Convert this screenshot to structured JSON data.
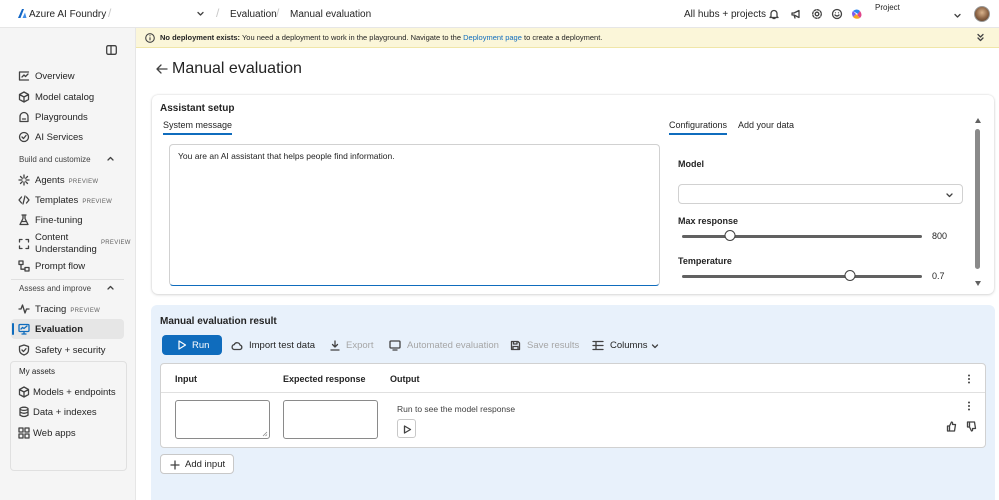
{
  "topbar": {
    "brand": "Azure AI Foundry",
    "breadcrumb": [
      "Evaluation",
      "Manual evaluation"
    ],
    "hubs_label": "All hubs + projects",
    "project_label": "Project"
  },
  "sidebar": {
    "main_items": [
      {
        "label": "Overview",
        "icon": "overview-icon"
      },
      {
        "label": "Model catalog",
        "icon": "model-catalog-icon"
      },
      {
        "label": "Playgrounds",
        "icon": "playgrounds-icon"
      },
      {
        "label": "AI Services",
        "icon": "ai-services-icon"
      }
    ],
    "section_build": "Build and customize",
    "build_items": [
      {
        "label": "Agents",
        "badge": "PREVIEW"
      },
      {
        "label": "Templates",
        "badge": "PREVIEW"
      },
      {
        "label": "Fine-tuning"
      },
      {
        "label": "Content Understanding",
        "badge": "PREVIEW"
      },
      {
        "label": "Prompt flow"
      }
    ],
    "section_assess": "Assess and improve",
    "assess_items": [
      {
        "label": "Tracing",
        "badge": "PREVIEW"
      },
      {
        "label": "Evaluation",
        "active": true
      },
      {
        "label": "Safety + security"
      }
    ],
    "section_assets": "My assets",
    "asset_items": [
      {
        "label": "Models + endpoints"
      },
      {
        "label": "Data + indexes"
      },
      {
        "label": "Web apps"
      }
    ]
  },
  "banner": {
    "title": "No deployment exists:",
    "text": " You need a deployment to work in the playground. Navigate to the ",
    "link": "Deployment page",
    "text2": " to create a deployment."
  },
  "page": {
    "title": "Manual evaluation"
  },
  "setup": {
    "title": "Assistant setup",
    "tab_system": "System message",
    "tab_config": "Configurations",
    "tab_data": "Add your data",
    "system_message": "You are an AI assistant that helps people find information.",
    "model_label": "Model",
    "model_value": "",
    "max_response_label": "Max response",
    "max_response_value": "800",
    "max_response_fraction": 0.2,
    "temperature_label": "Temperature",
    "temperature_value": "0.7",
    "temperature_fraction": 0.7
  },
  "eval": {
    "title": "Manual evaluation result",
    "run": "Run",
    "import": "Import test data",
    "export": "Export",
    "automated": "Automated evaluation",
    "save": "Save results",
    "columns": "Columns",
    "col_input": "Input",
    "col_expected": "Expected response",
    "col_output": "Output",
    "output_placeholder": "Run to see the model response",
    "add_input": "Add input"
  },
  "colors": {
    "accent": "#0f6cbd",
    "banner_bg": "#fbf6d9",
    "eval_bg": "#e8f1fb"
  }
}
